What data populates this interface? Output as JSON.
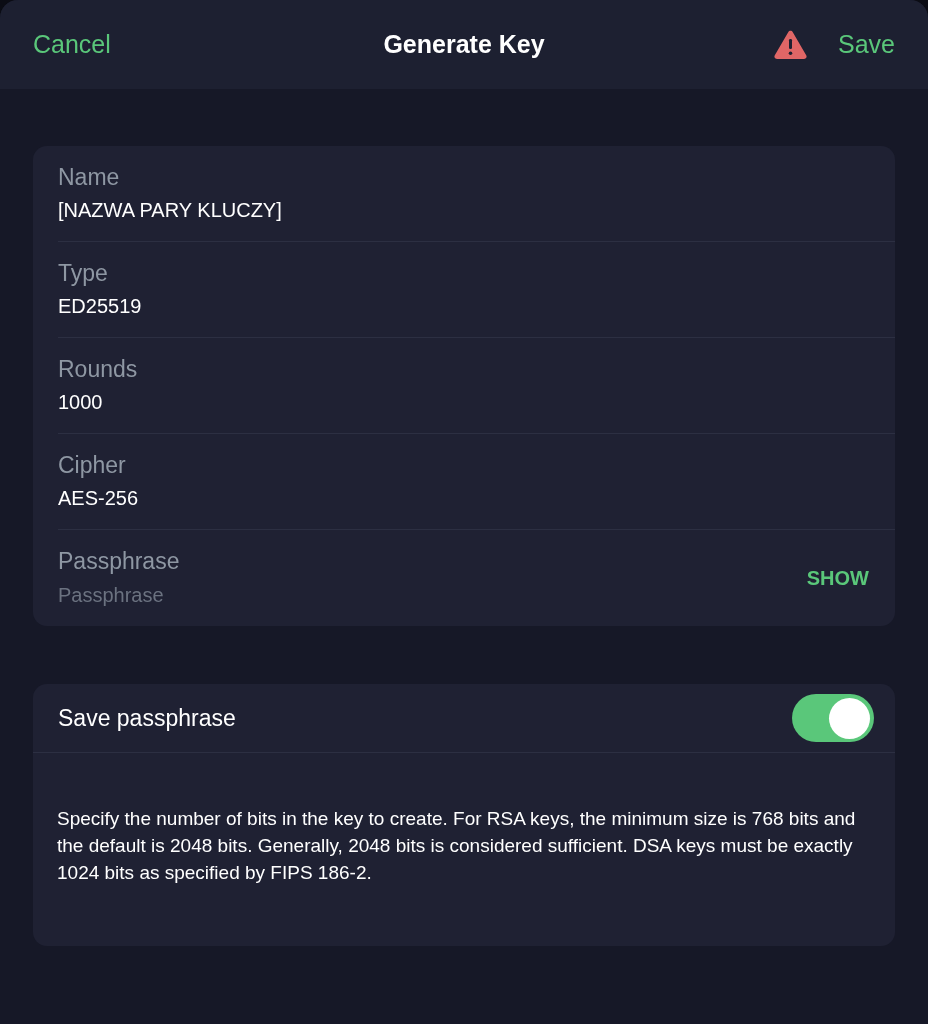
{
  "header": {
    "cancel": "Cancel",
    "title": "Generate Key",
    "save": "Save",
    "warning": true
  },
  "fields": [
    {
      "label": "Name",
      "value": "[NAZWA PARY KLUCZY]"
    },
    {
      "label": "Type",
      "value": "ED25519"
    },
    {
      "label": "Rounds",
      "value": "1000"
    },
    {
      "label": "Cipher",
      "value": "AES-256"
    },
    {
      "label": "Passphrase",
      "placeholder": "Passphrase",
      "action": "SHOW"
    }
  ],
  "save_passphrase": {
    "label": "Save passphrase",
    "on": true
  },
  "description": "Specify the number of bits in the key to create. For RSA keys, the minimum size is 768 bits and the default is 2048 bits. Generally, 2048 bits is considered sufficient. DSA keys must be exactly 1024 bits as specified by FIPS 186-2."
}
